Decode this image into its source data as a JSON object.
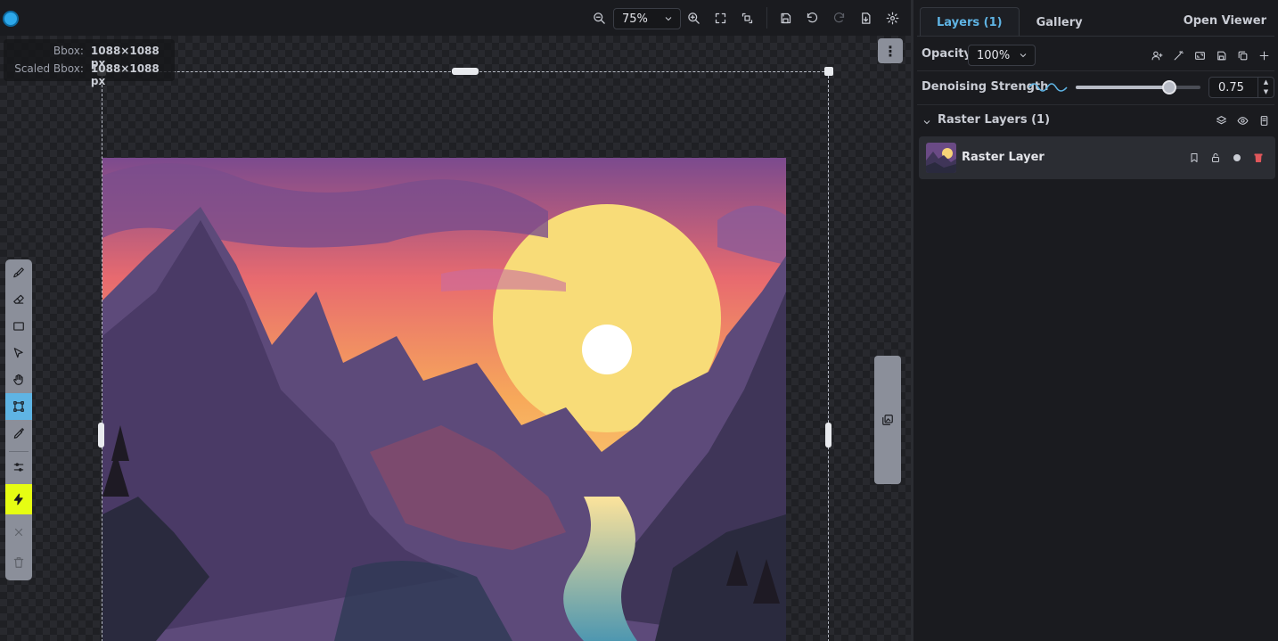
{
  "toolbar": {
    "zoom_value": "75%",
    "icons": [
      "zoom-out-icon",
      "zoom-in-icon",
      "fit-screen-icon",
      "fit-bbox-icon",
      "save-icon",
      "undo-icon",
      "redo-icon",
      "export-icon",
      "settings-icon"
    ]
  },
  "canvas": {
    "bbox_label": "Bbox:",
    "bbox_value": "1088×1088 px",
    "scaled_bbox_label": "Scaled Bbox:",
    "scaled_bbox_value": "1088×1088 px"
  },
  "tools": [
    "brush",
    "eraser",
    "rectangle",
    "move",
    "view",
    "transform",
    "color-picker",
    "settings",
    "invoke",
    "cancel",
    "delete"
  ],
  "panel": {
    "tabs": [
      {
        "label": "Layers (1)",
        "active": true
      },
      {
        "label": "Gallery",
        "active": false
      }
    ],
    "open_viewer": "Open Viewer",
    "opacity_label": "Opacity",
    "opacity_value": "100%",
    "denoise_label": "Denoising Strength",
    "denoise_value": "0.75",
    "denoise_fraction": 0.75,
    "group_title": "Raster Layers (1)",
    "layers": [
      {
        "name": "Raster Layer"
      }
    ]
  },
  "colors": {
    "accent": "#5fb4e4",
    "invoke": "#e6fd13",
    "danger": "#e0575b"
  }
}
